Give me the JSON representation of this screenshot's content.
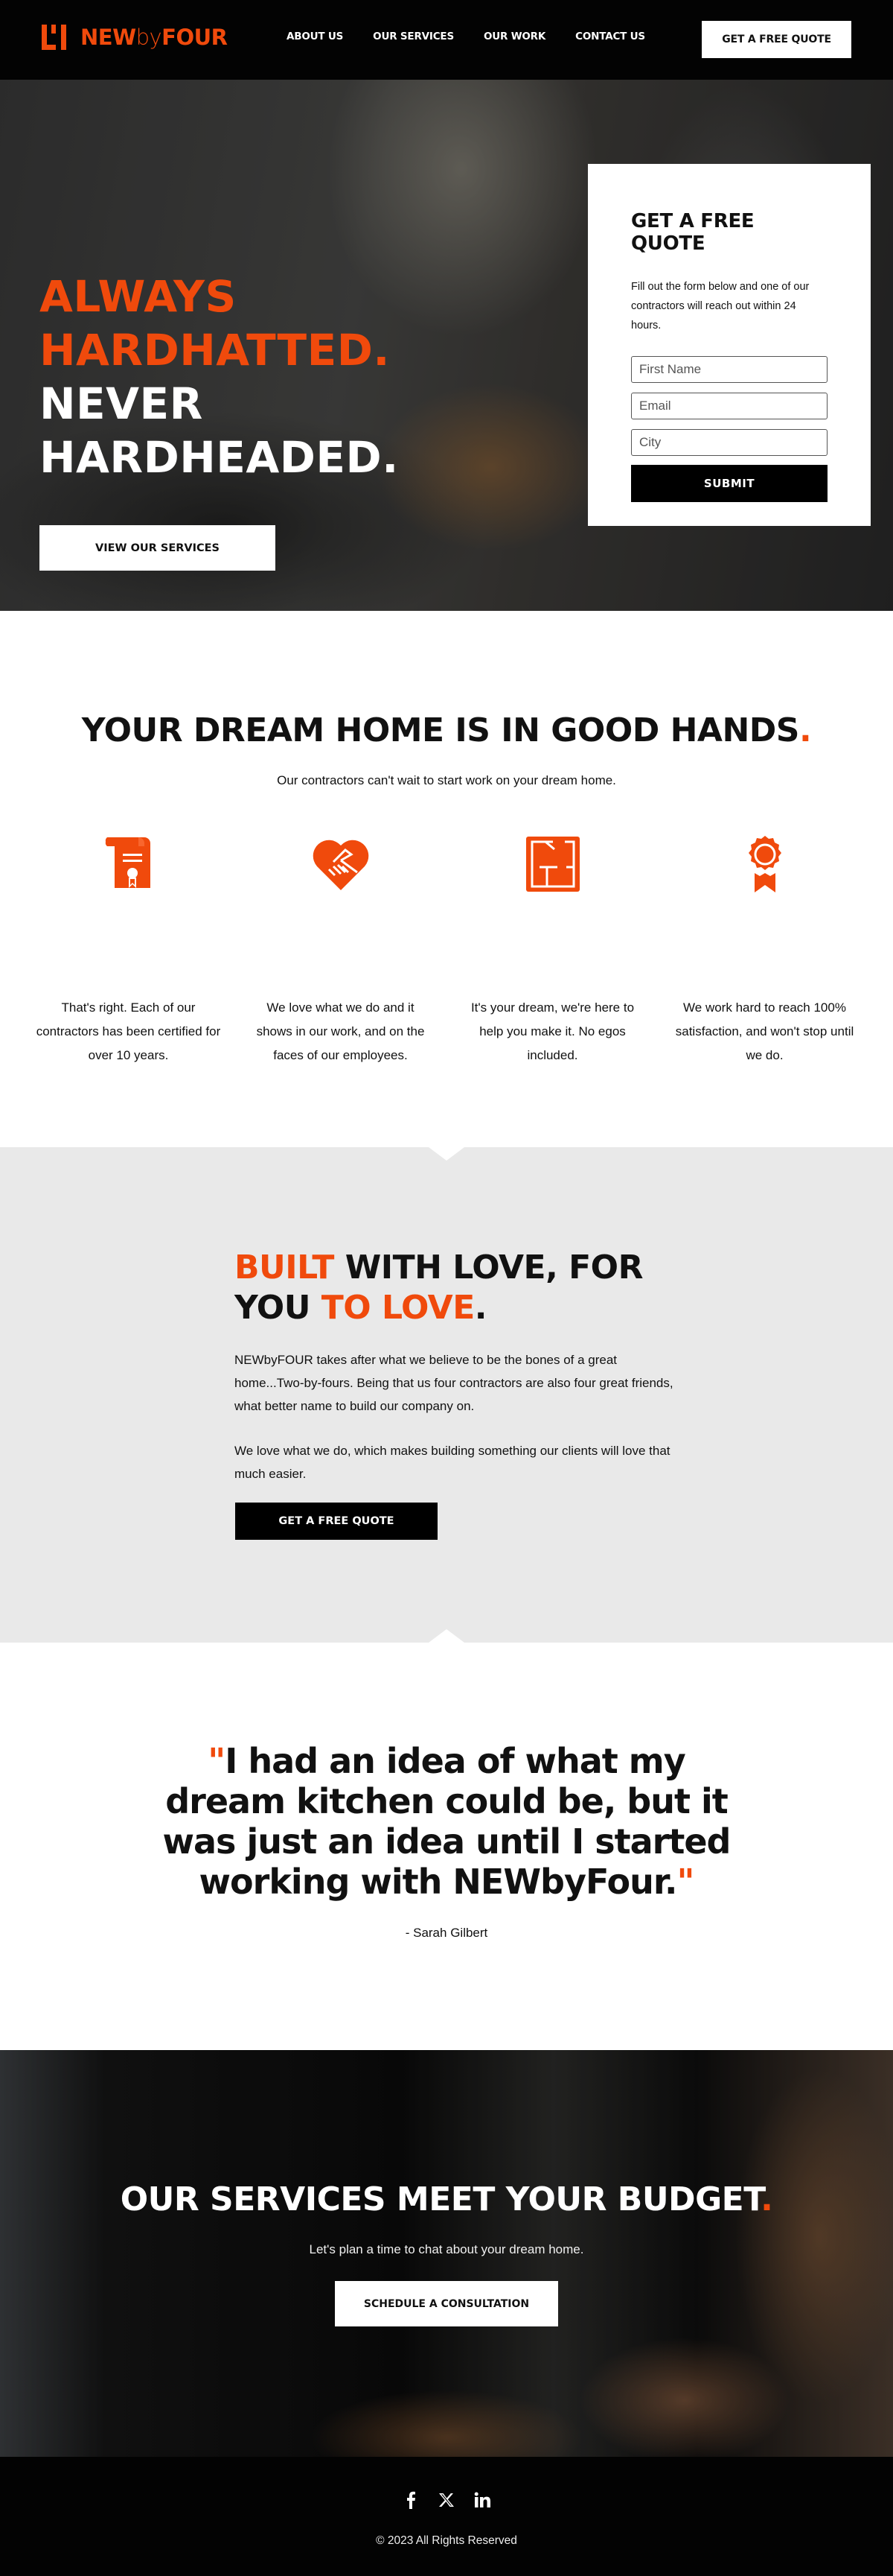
{
  "brand": {
    "name_bold_1": "NEW",
    "name_light": "by",
    "name_bold_2": "FOUR",
    "accent_color": "#f04a0c"
  },
  "nav": {
    "items": [
      {
        "label": "ABOUT US"
      },
      {
        "label": "OUR SERVICES"
      },
      {
        "label": "OUR WORK"
      },
      {
        "label": "CONTACT US"
      }
    ],
    "cta_label": "GET A FREE QUOTE"
  },
  "hero": {
    "line1": "ALWAYS",
    "line2": "HARDHATTED.",
    "line3": "NEVER",
    "line4": "HARDHEADED.",
    "button_label": "VIEW OUR SERVICES"
  },
  "quote_form": {
    "title": "GET A FREE QUOTE",
    "description": "Fill out the form below and one of our contractors will reach out within 24 hours.",
    "first_name_placeholder": "First Name",
    "email_placeholder": "Email",
    "city_placeholder": "City",
    "submit_label": "SUBMIT"
  },
  "good_hands": {
    "title": "YOUR DREAM HOME IS IN GOOD HANDS",
    "title_punct": ".",
    "subtitle": "Our contractors can't wait to start work on your dream home.",
    "features": [
      {
        "icon": "certificate-icon",
        "text": "That's right. Each of our contractors has been certified for over 10 years."
      },
      {
        "icon": "heart-handshake-icon",
        "text": "We love what we do and it shows in our work, and on the faces of our employees."
      },
      {
        "icon": "floor-plan-icon",
        "text": "It's your dream, we're here to help you make it. No egos included."
      },
      {
        "icon": "award-ribbon-icon",
        "text": "We work hard to reach 100% satisfaction, and won't stop until we do."
      }
    ]
  },
  "built": {
    "title_orange_1": "BUILT",
    "title_black_1": " WITH LOVE, FOR YOU ",
    "title_orange_2": "TO LOVE",
    "title_punct": ".",
    "paragraph_1": "NEWbyFOUR takes after what we believe to be the bones of a great home...Two-by-fours. Being that us four contractors are also four great friends, what better name to build our company on.",
    "paragraph_2": "We love what we do, which makes building something our clients will love that much easier.",
    "button_label": "GET A FREE QUOTE"
  },
  "testimonial": {
    "open_quote": "\"",
    "quote": "I had an idea of what my dream kitchen could be, but it was just an idea until I started working with NEWbyFour.",
    "close_quote": "\"",
    "author": "- Sarah Gilbert"
  },
  "cta": {
    "title": "OUR SERVICES MEET YOUR BUDGET",
    "title_punct": ".",
    "subtitle": "Let's plan a time to chat about your dream home.",
    "button_label": "SCHEDULE A CONSULTATION"
  },
  "footer": {
    "socials": [
      {
        "icon": "facebook-icon"
      },
      {
        "icon": "x-twitter-icon"
      },
      {
        "icon": "linkedin-icon"
      }
    ],
    "copyright": "© 2023 All Rights Reserved"
  }
}
